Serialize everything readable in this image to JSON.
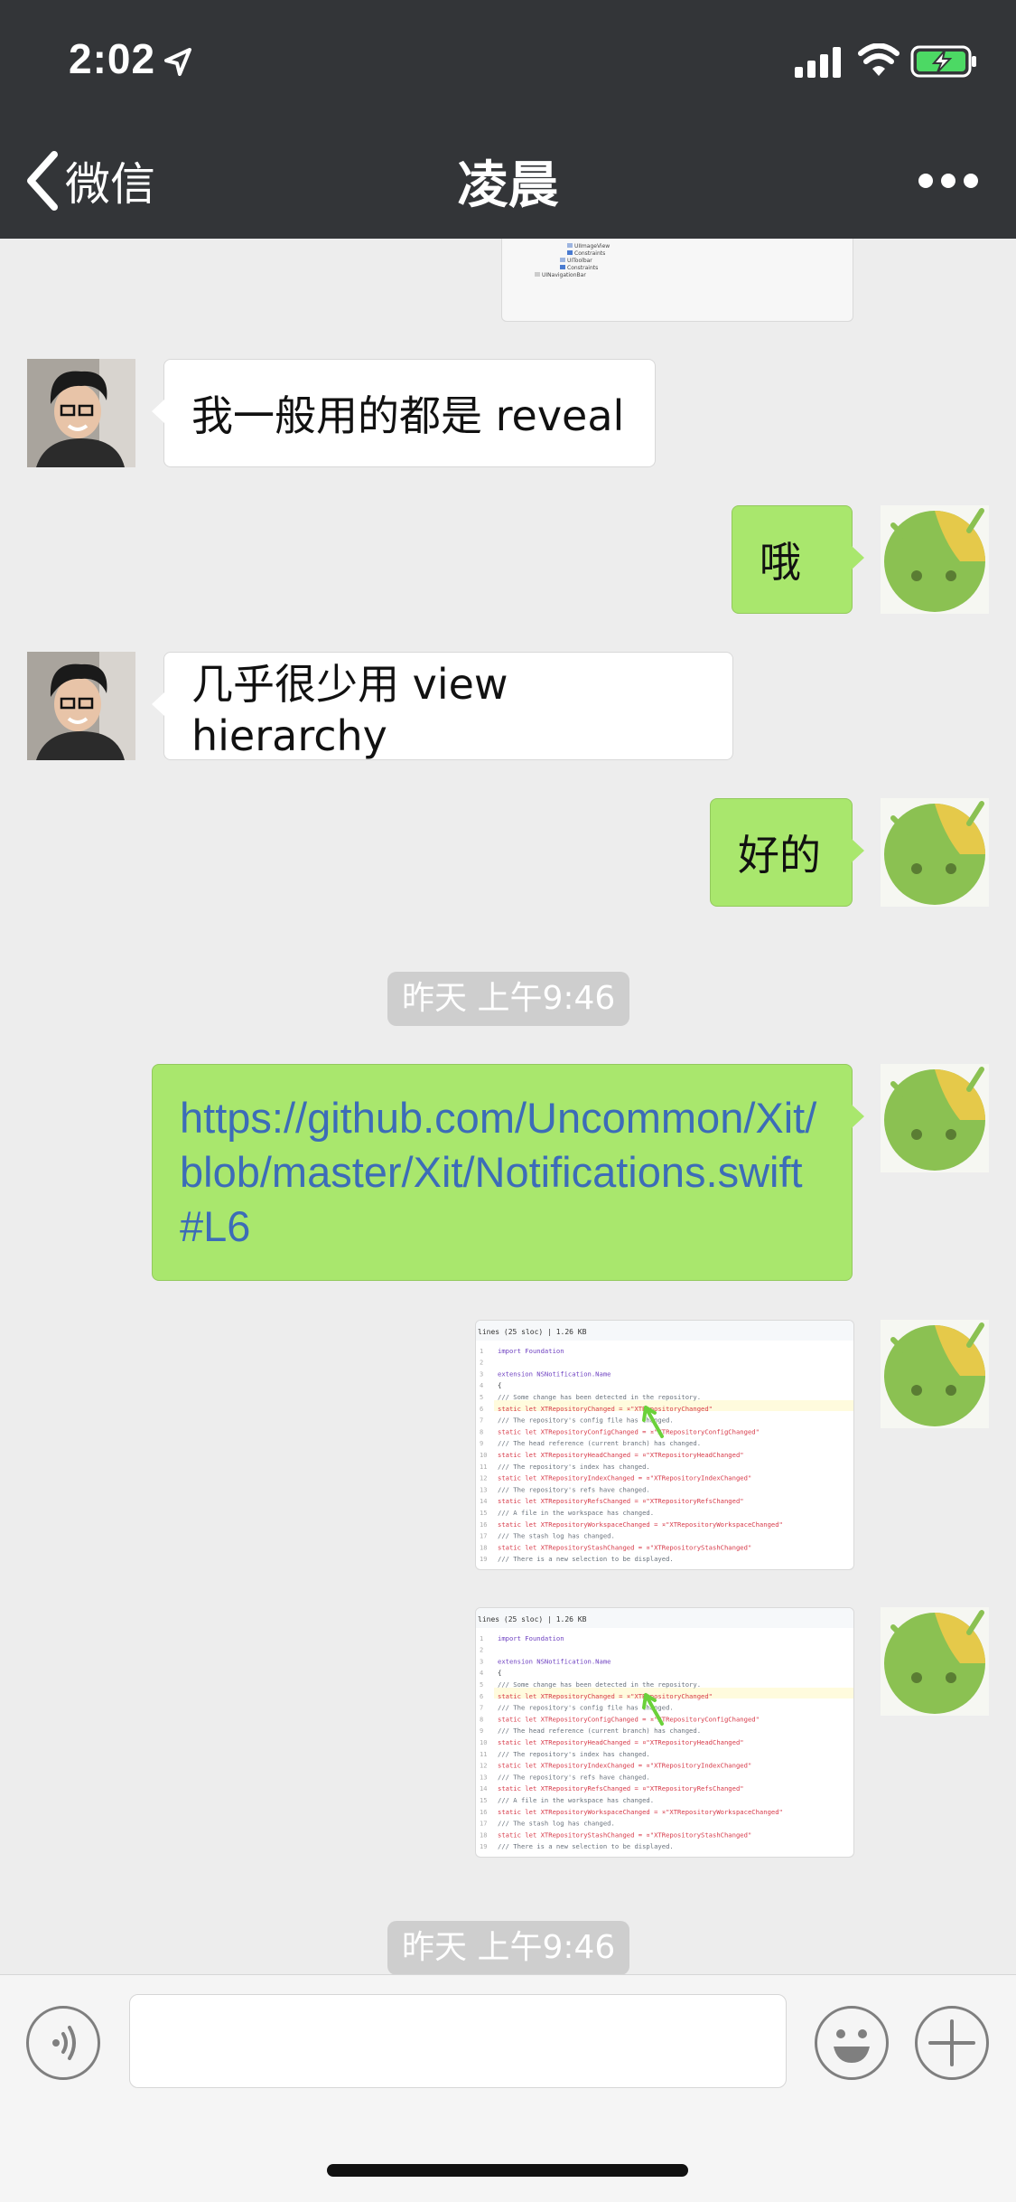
{
  "status_bar": {
    "time": "2:02"
  },
  "nav": {
    "back_label": "微信",
    "title": "凌晨"
  },
  "messages": {
    "m1": "我一般用的都是 reveal",
    "m2": "哦",
    "m3": "几乎很少用 view hierarchy",
    "m4": "好的",
    "m5_link": "https://github.com/Uncommon/Xit/blob/master/Xit/Notifications.swift#L6"
  },
  "timestamps": {
    "t1": "昨天 上午9:46",
    "t2": "昨天 上午9:46"
  },
  "code_preview": {
    "header": "lines (25 sloc)  |  1.26 KB",
    "lines": [
      "import Foundation",
      "",
      "extension NSNotification.Name",
      "{",
      "  /// Some change has been detected in the repository.",
      "  static let XTRepositoryChanged = ¤\"XTRepositoryChanged\"",
      "  /// The repository's config file has changed.",
      "  static let XTRepositoryConfigChanged = ¤\"XTRepositoryConfigChanged\"",
      "  /// The head reference (current branch) has changed.",
      "  static let XTRepositoryHeadChanged = ¤\"XTRepositoryHeadChanged\"",
      "  /// The repository's index has changed.",
      "  static let XTRepositoryIndexChanged = ¤\"XTRepositoryIndexChanged\"",
      "  /// The repository's refs have changed.",
      "  static let XTRepositoryRefsChanged = ¤\"XTRepositoryRefsChanged\"",
      "  /// A file in the workspace has changed.",
      "  static let XTRepositoryWorkspaceChanged = ¤\"XTRepositoryWorkspaceChanged\"",
      "  /// The stash log has changed.",
      "  static let XTRepositoryStashChanged = ¤\"XTRepositoryStashChanged\"",
      "  /// There is a new selection to be displayed."
    ]
  },
  "tree_preview": [
    "UIImageView",
    "Constraints",
    "UIToolbar",
    "Constraints",
    "UINavigationBar"
  ],
  "colors": {
    "nav_bg": "#333538",
    "bubble_out": "#a9e76d",
    "link": "#3c6cb8",
    "chat_bg": "#ededed"
  }
}
